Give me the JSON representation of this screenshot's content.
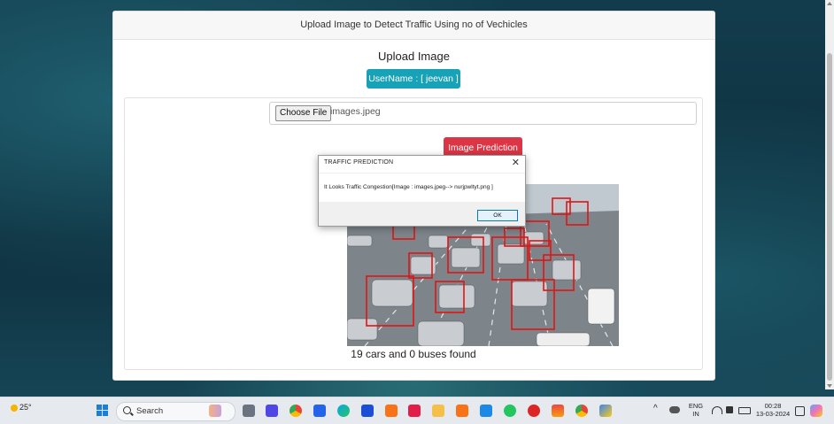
{
  "page": {
    "card_header": "Upload Image to Detect Traffic Using no of Vechicles",
    "upload_title": "Upload Image",
    "username_badge": "UserName : [ jeevan ]",
    "choose_file_label": "Choose File",
    "file_name": "images.jpeg",
    "predict_button": "Image Prediction",
    "result_text": "19 cars and 0 buses found"
  },
  "dialog": {
    "title": "TRAFFIC PREDICTION",
    "close_glyph": "✕",
    "message": "It Looks Traffic Congestion[Image : images.jpeg--> nurjpwltyt.png ]",
    "ok_label": "OK"
  },
  "taskbar": {
    "weather": "25°",
    "search_label": "Search",
    "chevron": "^",
    "lang_line1": "ENG",
    "lang_line2": "IN",
    "time": "00:28",
    "date": "13-03-2024",
    "apps": [
      "widgets-icon",
      "file-explorer-icon",
      "meet-icon",
      "chrome-icon",
      "store-icon",
      "edge-icon",
      "todo-icon",
      "brave-icon",
      "youtube-icon",
      "folder-icon",
      "xampp-icon",
      "vscode-icon",
      "whatsapp-icon",
      "powerpoint-icon",
      "app-icon",
      "chrome-profile-icon",
      "python-icon"
    ],
    "colors": {
      "accent_info": "#17a2b8",
      "accent_danger": "#dc3545",
      "windows_blue": "#1c7fd6"
    }
  }
}
